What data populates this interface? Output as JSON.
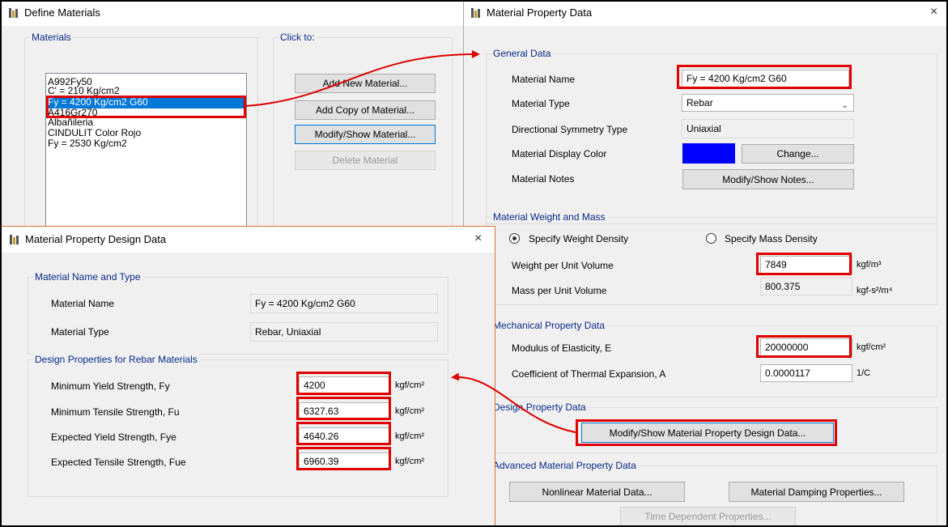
{
  "define_materials": {
    "title": "Define Materials",
    "materials_group": "Materials",
    "click_to_group": "Click to:",
    "list": [
      "A992Fy50",
      "C' = 210 Kg/cm2",
      "Fy = 4200 Kg/cm2 G60",
      "A416Gr270",
      "Albañileria",
      "CINDULIT Color Rojo",
      "Fy = 2530 Kg/cm2"
    ],
    "selected_index": 2,
    "buttons": {
      "add_new": "Add New Material...",
      "add_copy": "Add Copy of Material...",
      "modify_show": "Modify/Show Material...",
      "delete": "Delete Material"
    }
  },
  "material_property": {
    "title": "Material Property Data",
    "close_glyph": "×",
    "general": {
      "group": "General Data",
      "name_label": "Material Name",
      "name_value": "Fy = 4200 Kg/cm2 G60",
      "type_label": "Material Type",
      "type_value": "Rebar",
      "symmetry_label": "Directional Symmetry Type",
      "symmetry_value": "Uniaxial",
      "color_label": "Material Display Color",
      "color_value": "#0000ff",
      "change_button": "Change...",
      "notes_label": "Material Notes",
      "notes_button": "Modify/Show Notes..."
    },
    "weight": {
      "group": "Material Weight and Mass",
      "radio_weight": "Specify Weight Density",
      "radio_mass": "Specify Mass Density",
      "weight_label": "Weight per Unit Volume",
      "weight_value": "7849",
      "weight_unit": "kgf/m³",
      "mass_label": "Mass per Unit Volume",
      "mass_value": "800.375",
      "mass_unit": "kgf-s²/m⁴"
    },
    "mechanical": {
      "group": "Mechanical Property Data",
      "e_label": "Modulus of Elasticity,  E",
      "e_value": "20000000",
      "e_unit": "kgf/cm²",
      "a_label": "Coefficient of Thermal Expansion,  A",
      "a_value": "0.0000117",
      "a_unit": "1/C"
    },
    "design": {
      "group": "Design Property Data",
      "button": "Modify/Show Material Property Design Data..."
    },
    "advanced": {
      "group": "Advanced Material Property Data",
      "nonlinear": "Nonlinear Material Data...",
      "damping": "Material Damping Properties...",
      "time_dependent": "Time Dependent Properties..."
    }
  },
  "design_data": {
    "title": "Material Property Design Data",
    "close_glyph": "×",
    "name_type_group": "Material Name and Type",
    "name_label": "Material Name",
    "name_value": "Fy = 4200 Kg/cm2 G60",
    "type_label": "Material Type",
    "type_value": "Rebar, Uniaxial",
    "rebar_group": "Design Properties for Rebar Materials",
    "rows": [
      {
        "label": "Minimum Yield Strength, Fy",
        "value": "4200",
        "unit": "kgf/cm²"
      },
      {
        "label": "Minimum Tensile Strength, Fu",
        "value": "6327.63",
        "unit": "kgf/cm²"
      },
      {
        "label": "Expected Yield Strength, Fye",
        "value": "4640.26",
        "unit": "kgf/cm²"
      },
      {
        "label": "Expected Tensile Strength, Fue",
        "value": "6960.39",
        "unit": "kgf/cm²"
      }
    ]
  },
  "colors": {
    "annotation_red": "#e00000",
    "group_label_blue": "#0a2a8a",
    "selection_blue": "#0078d7",
    "window_border_orange": "#e07030"
  }
}
